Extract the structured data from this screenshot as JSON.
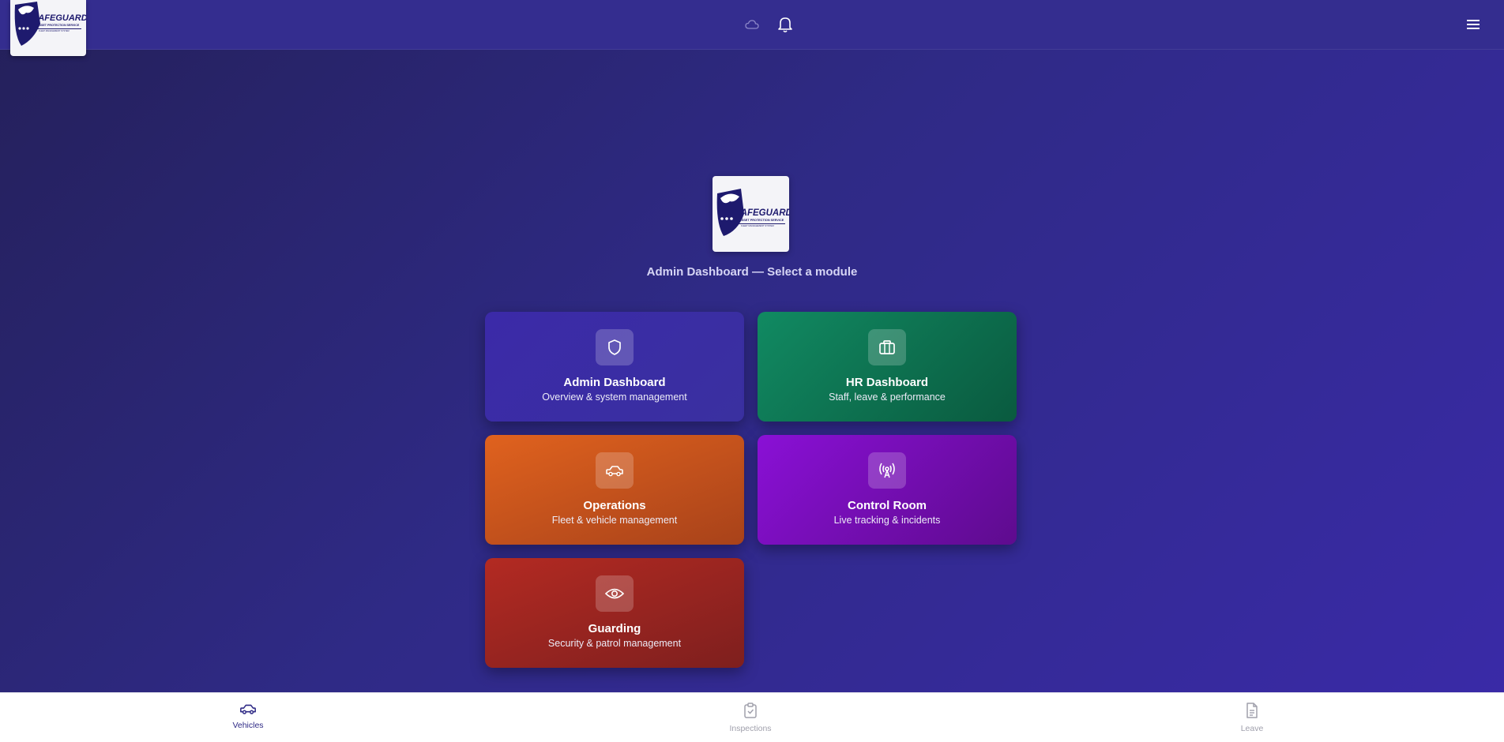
{
  "header": {
    "logo": {
      "brand": "SAFEGUARD",
      "tagline": "ASSET PROTECTION SERVICE",
      "system": "FLEET MANAGEMENT SYSTEM"
    },
    "icons": [
      "cloud-icon",
      "bell-icon",
      "menu-icon"
    ]
  },
  "main": {
    "logo": {
      "brand": "SAFEGUARD",
      "tagline": "ASSET PROTECTION SERVICE",
      "system": "FLEET MANAGEMENT SYSTEM"
    },
    "subtitle": "Admin Dashboard — Select a module",
    "modules": [
      {
        "title": "Admin Dashboard",
        "description": "Overview & system management",
        "icon": "shield-icon",
        "color": "#3b2aa8"
      },
      {
        "title": "HR Dashboard",
        "description": "Staff, leave & performance",
        "icon": "briefcase-icon",
        "color": "#0f7a56"
      },
      {
        "title": "Operations",
        "description": "Fleet & vehicle management",
        "icon": "car-icon",
        "color": "#d2591d"
      },
      {
        "title": "Control Room",
        "description": "Live tracking & incidents",
        "icon": "radio-tower-icon",
        "color": "#7a0fbf"
      },
      {
        "title": "Guarding",
        "description": "Security & patrol management",
        "icon": "eye-icon",
        "color": "#a12721"
      }
    ]
  },
  "bottom_nav": {
    "items": [
      {
        "label": "Vehicles",
        "icon": "car-icon",
        "active": true
      },
      {
        "label": "Inspections",
        "icon": "clipboard-check-icon",
        "active": false
      },
      {
        "label": "Leave",
        "icon": "document-icon",
        "active": false
      }
    ],
    "active_color": "#2f2a86"
  }
}
